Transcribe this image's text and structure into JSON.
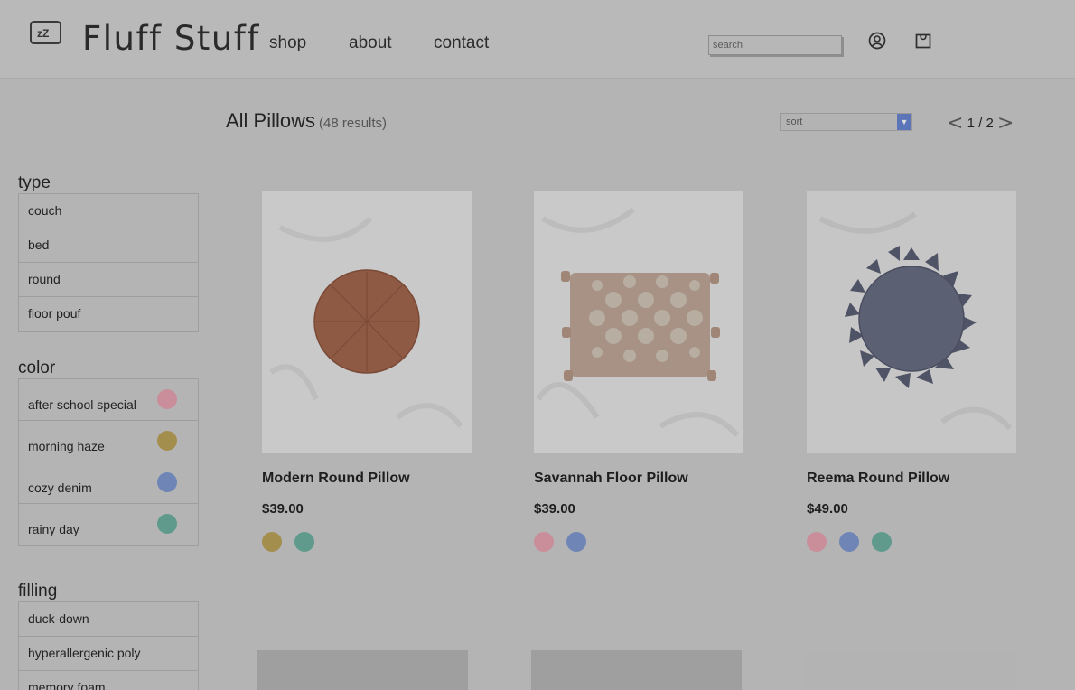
{
  "brand": {
    "name": "Fluff Stuff",
    "logo_icon": "sleeping-face-icon",
    "logo_text": "zZ"
  },
  "nav": [
    {
      "label": "shop"
    },
    {
      "label": "about"
    },
    {
      "label": "contact"
    }
  ],
  "search": {
    "placeholder": "search",
    "value": ""
  },
  "header_icons": [
    "account-icon",
    "cart-icon"
  ],
  "listing": {
    "title": "All Pillows",
    "count": "(48 results)",
    "sort_placeholder": "sort",
    "pager": {
      "prev": "<",
      "text": "1 / 2",
      "next": ">"
    }
  },
  "colors": {
    "pink": "#c98e9a",
    "mustard": "#a48e4e",
    "denim": "#6e85b6",
    "teal": "#5f9a8d"
  },
  "filters": {
    "type": {
      "heading": "type",
      "items": [
        "couch",
        "bed",
        "round",
        "floor pouf"
      ]
    },
    "color": {
      "heading": "color",
      "items": [
        {
          "label": "after school special",
          "color": "#c98e9a"
        },
        {
          "label": "morning haze",
          "color": "#a48e4e"
        },
        {
          "label": "cozy denim",
          "color": "#6e85b6"
        },
        {
          "label": "rainy day",
          "color": "#5f9a8d"
        }
      ]
    },
    "filling": {
      "heading": "filling",
      "items": [
        "duck-down",
        "hyperallergenic poly",
        "memory foam"
      ]
    }
  },
  "products": [
    {
      "name": "Modern Round Pillow",
      "price": "$39.00",
      "swatches": [
        "#a48e4e",
        "#5f9a8d"
      ]
    },
    {
      "name": "Savannah Floor Pillow",
      "price": "$39.00",
      "swatches": [
        "#c98e9a",
        "#6e85b6"
      ]
    },
    {
      "name": "Reema Round Pillow",
      "price": "$49.00",
      "swatches": [
        "#c98e9a",
        "#6e85b6",
        "#5f9a8d"
      ]
    }
  ]
}
